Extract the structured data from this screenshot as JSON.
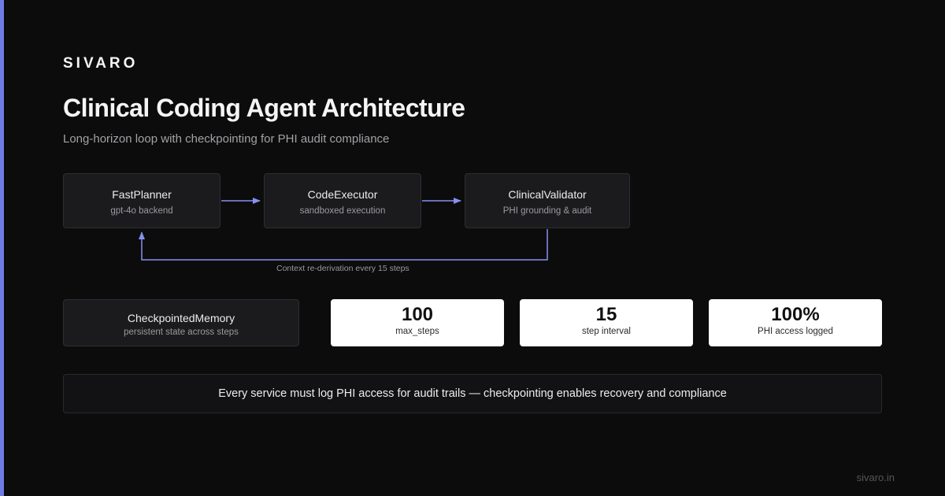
{
  "brand": "SIVARO",
  "title": "Clinical Coding Agent Architecture",
  "subtitle": "Long-horizon loop with checkpointing for PHI audit compliance",
  "nodes": {
    "planner": {
      "title": "FastPlanner",
      "sub": "gpt-4o backend"
    },
    "executor": {
      "title": "CodeExecutor",
      "sub": "sandboxed execution"
    },
    "validator": {
      "title": "ClinicalValidator",
      "sub": "PHI grounding & audit"
    },
    "memory": {
      "title": "CheckpointedMemory",
      "sub": "persistent state across steps"
    }
  },
  "loop_label": "Context re-derivation every 15 steps",
  "stats": [
    {
      "value": "100",
      "label": "max_steps"
    },
    {
      "value": "15",
      "label": "step interval"
    },
    {
      "value": "100%",
      "label": "PHI access logged"
    }
  ],
  "note": "Every service must log PHI access for audit trails — checkpointing enables recovery and compliance",
  "footer": "sivaro.in",
  "colors": {
    "accent": "#6f7be6",
    "arrow": "#8890f0",
    "background": "#0c0c0c",
    "card": "#1b1b1d",
    "stat_card": "#ffffff"
  }
}
